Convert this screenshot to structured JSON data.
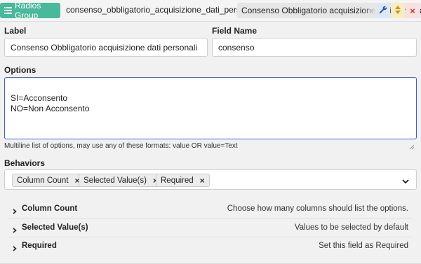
{
  "header": {
    "type_label": "Radios Group",
    "field_name": "consenso_obbligatorio_acquisizione_dati_personali",
    "field_label": "Consenso Obbligatorio acquisizione dati personali",
    "icons": {
      "type": "list-icon",
      "edit": "wrench-icon",
      "sort": "sort-icon",
      "close": "close-icon"
    },
    "close_symbol": "×"
  },
  "form": {
    "label": {
      "title": "Label",
      "value": "Consenso Obbligatorio acquisizione dati personali"
    },
    "field_name": {
      "title": "Field Name",
      "value": "consenso"
    },
    "options": {
      "title": "Options",
      "value": "SI=Acconsento\nNO=Non Acconsento",
      "hint": "Multiline list of options, may use any of these formats: value OR value=Text"
    },
    "behaviors": {
      "title": "Behaviors",
      "tags": [
        "Column Count",
        "Selected Value(s)",
        "Required"
      ],
      "remove_symbol": "×"
    }
  },
  "accordion": [
    {
      "title": "Column Count",
      "description": "Choose how many columns should list the options."
    },
    {
      "title": "Selected Value(s)",
      "description": "Values to be selected by default"
    },
    {
      "title": "Required",
      "description": "Set this field as Required"
    }
  ],
  "colors": {
    "badge": "#4ab89a",
    "focus_border": "#3d5fd0",
    "close_red": "#c0392b"
  }
}
